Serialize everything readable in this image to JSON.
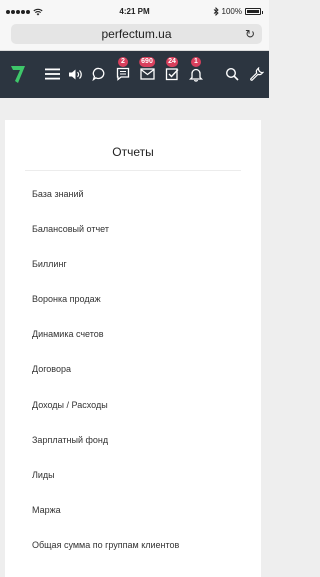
{
  "status_bar": {
    "time": "4:21 PM",
    "battery": "100%"
  },
  "browser": {
    "url": "perfectum.ua"
  },
  "nav": {
    "badges": {
      "messages": "2",
      "mail": "690",
      "tasks": "24",
      "notifications": "1"
    }
  },
  "reports": {
    "title": "Отчеты",
    "items": [
      "База знаний",
      "Балансовый отчет",
      "Биллинг",
      "Воронка продаж",
      "Динамика счетов",
      "Договора",
      "Доходы / Расходы",
      "Зарплатный фонд",
      "Лиды",
      "Маржа",
      "Общая сумма по группам клиентов"
    ]
  },
  "colors": {
    "navbar": "#2c3540",
    "badge": "#d8405d",
    "logo": "#3ec76a"
  }
}
